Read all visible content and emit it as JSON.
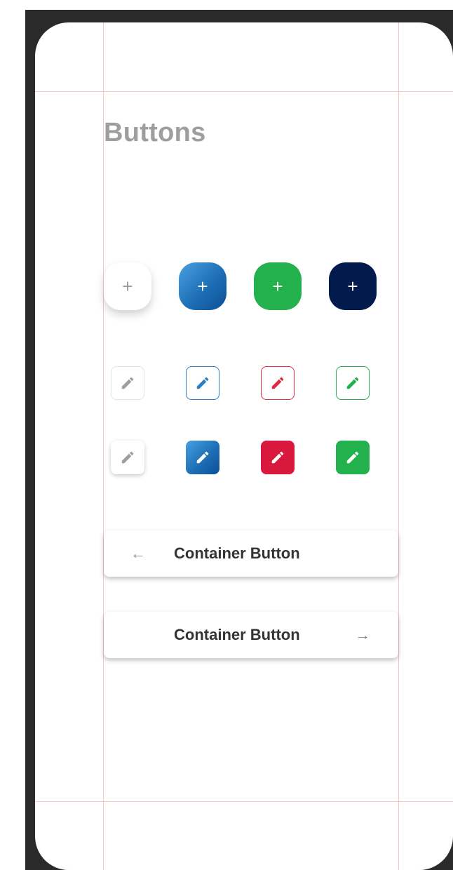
{
  "page": {
    "title": "Buttons"
  },
  "fab_row": [
    {
      "icon": "plus-icon",
      "glyph": "+",
      "style": "white",
      "text_color": "#9a9a9a",
      "bg": "#ffffff"
    },
    {
      "icon": "plus-icon",
      "glyph": "+",
      "style": "blue-gradient",
      "text_color": "#ffffff",
      "bg": "#1e6fb6"
    },
    {
      "icon": "plus-icon",
      "glyph": "+",
      "style": "green",
      "text_color": "#ffffff",
      "bg": "#22b14c"
    },
    {
      "icon": "plus-icon",
      "glyph": "+",
      "style": "navy",
      "text_color": "#ffffff",
      "bg": "#031a4d"
    }
  ],
  "outlined_icon_row": [
    {
      "icon": "pencil-icon",
      "color": "#9e9e9e",
      "border": "#e3e3e3"
    },
    {
      "icon": "pencil-icon",
      "color": "#2d7ec4",
      "border": "#2d7ec4"
    },
    {
      "icon": "pencil-icon",
      "color": "#de2a45",
      "border": "#de2a45"
    },
    {
      "icon": "pencil-icon",
      "color": "#22b14c",
      "border": "#22b14c"
    }
  ],
  "filled_icon_row": [
    {
      "icon": "pencil-icon",
      "color": "#9e9e9e",
      "bg": "#ffffff"
    },
    {
      "icon": "pencil-icon",
      "color": "#ffffff",
      "bg": "#1e6fb6"
    },
    {
      "icon": "pencil-icon",
      "color": "#ffffff",
      "bg": "#d9183d"
    },
    {
      "icon": "pencil-icon",
      "color": "#ffffff",
      "bg": "#22b14c"
    }
  ],
  "container_buttons": [
    {
      "label": "Container Button",
      "icon": "arrow-left-icon",
      "arrow": "←"
    },
    {
      "label": "Container Button",
      "icon": "arrow-right-icon",
      "arrow": "→"
    }
  ],
  "colors": {
    "title": "#9e9e9e",
    "guide": "#f6c7c7",
    "frame": "#2a2a2a",
    "label": "#333333"
  }
}
